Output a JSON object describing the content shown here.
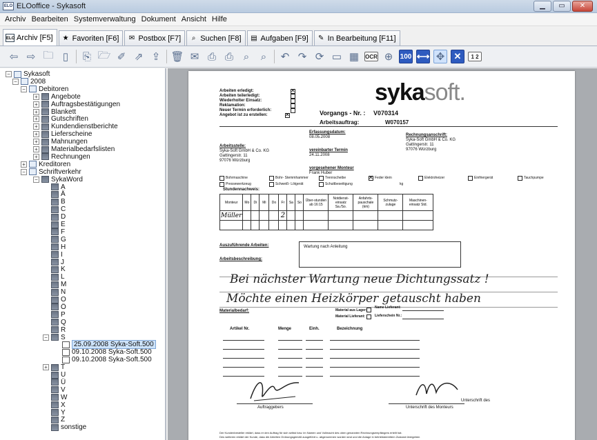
{
  "window": {
    "title": "ELOoffice - Sykasoft",
    "app_icon": "ELO",
    "controls": {
      "minimize": "▁",
      "maximize": "▭",
      "close": "✕"
    }
  },
  "menu": [
    "Archiv",
    "Bearbeiten",
    "Systemverwaltung",
    "Dokument",
    "Ansicht",
    "Hilfe"
  ],
  "tabs": [
    {
      "label": "Archiv [F5]",
      "icon": "ELO",
      "active": true
    },
    {
      "label": "Favoriten [F6]",
      "icon": "★"
    },
    {
      "label": "Postbox [F7]",
      "icon": "✉"
    },
    {
      "label": "Suchen [F8]",
      "icon": "⌕"
    },
    {
      "label": "Aufgaben [F9]",
      "icon": "▤"
    },
    {
      "label": "In Bearbeitung [F11]",
      "icon": "✎"
    }
  ],
  "toolbar_icons": [
    "back-arrow-icon",
    "forward-arrow-icon",
    "new-folder-icon",
    "new-document-icon",
    "sep",
    "insert-document-icon",
    "open-folder-icon",
    "edit-icon",
    "move-icon",
    "export-icon",
    "sep",
    "trash-icon",
    "mail-icon",
    "print-icon",
    "print-preview-icon",
    "search-doc-icon",
    "find-next-icon",
    "sep",
    "rotate-left-icon",
    "rotate-right-icon",
    "refresh-icon",
    "scanner-icon",
    "grid-icon",
    "ocr-icon",
    "zoom-in-icon",
    "zoom-100-icon",
    "fit-width-icon",
    "fit-page-icon",
    "close-doc-icon",
    "page-12-icon"
  ],
  "toolbar_labels": {
    "ocr": "OCR",
    "zoom100": "100",
    "pages": "1 2"
  },
  "tree": [
    {
      "label": "Sykasoft",
      "level": 0,
      "icon": "cab",
      "exp": "−"
    },
    {
      "label": "2008",
      "level": 1,
      "icon": "cab",
      "exp": "−"
    },
    {
      "label": "Debitoren",
      "level": 2,
      "icon": "cab",
      "exp": "−"
    },
    {
      "label": "Angebote",
      "level": 3,
      "icon": "fold",
      "exp": "+"
    },
    {
      "label": "Auftragsbestätigungen",
      "level": 3,
      "icon": "fold",
      "exp": "+"
    },
    {
      "label": "Blankett",
      "level": 3,
      "icon": "fold",
      "exp": "+"
    },
    {
      "label": "Gutschriften",
      "level": 3,
      "icon": "fold",
      "exp": "+"
    },
    {
      "label": "Kundendienstberichte",
      "level": 3,
      "icon": "fold",
      "exp": "+"
    },
    {
      "label": "Lieferscheine",
      "level": 3,
      "icon": "fold",
      "exp": "+"
    },
    {
      "label": "Mahnungen",
      "level": 3,
      "icon": "fold",
      "exp": "+"
    },
    {
      "label": "Materialbedarfslisten",
      "level": 3,
      "icon": "fold",
      "exp": "+"
    },
    {
      "label": "Rechnungen",
      "level": 3,
      "icon": "fold",
      "exp": "+"
    },
    {
      "label": "Kreditoren",
      "level": 2,
      "icon": "cab",
      "exp": "+"
    },
    {
      "label": "Schriftverkehr",
      "level": 2,
      "icon": "cab",
      "exp": "−"
    },
    {
      "label": "SykaWord",
      "level": 3,
      "icon": "fold",
      "exp": "−"
    },
    {
      "label": "A",
      "level": 4,
      "icon": "fold"
    },
    {
      "label": "Ä",
      "level": 4,
      "icon": "fold"
    },
    {
      "label": "B",
      "level": 4,
      "icon": "fold"
    },
    {
      "label": "C",
      "level": 4,
      "icon": "fold"
    },
    {
      "label": "D",
      "level": 4,
      "icon": "fold"
    },
    {
      "label": "E",
      "level": 4,
      "icon": "fold"
    },
    {
      "label": "F",
      "level": 4,
      "icon": "fold"
    },
    {
      "label": "G",
      "level": 4,
      "icon": "fold"
    },
    {
      "label": "H",
      "level": 4,
      "icon": "fold"
    },
    {
      "label": "I",
      "level": 4,
      "icon": "fold"
    },
    {
      "label": "J",
      "level": 4,
      "icon": "fold"
    },
    {
      "label": "K",
      "level": 4,
      "icon": "fold"
    },
    {
      "label": "L",
      "level": 4,
      "icon": "fold"
    },
    {
      "label": "M",
      "level": 4,
      "icon": "fold"
    },
    {
      "label": "N",
      "level": 4,
      "icon": "fold"
    },
    {
      "label": "O",
      "level": 4,
      "icon": "fold"
    },
    {
      "label": "Ö",
      "level": 4,
      "icon": "fold"
    },
    {
      "label": "P",
      "level": 4,
      "icon": "fold"
    },
    {
      "label": "Q",
      "level": 4,
      "icon": "fold"
    },
    {
      "label": "R",
      "level": 4,
      "icon": "fold"
    },
    {
      "label": "S",
      "level": 4,
      "icon": "fold",
      "exp": "−"
    },
    {
      "label": "25.09.2008  Syka-Soft.500",
      "level": 5,
      "icon": "doc",
      "selected": true
    },
    {
      "label": "09.10.2008  Syka-Soft.500",
      "level": 5,
      "icon": "doc"
    },
    {
      "label": "09.10.2008  Syka-Soft.500",
      "level": 5,
      "icon": "doc"
    },
    {
      "label": "T",
      "level": 4,
      "icon": "fold",
      "exp": "+"
    },
    {
      "label": "U",
      "level": 4,
      "icon": "fold"
    },
    {
      "label": "Ü",
      "level": 4,
      "icon": "fold"
    },
    {
      "label": "V",
      "level": 4,
      "icon": "fold"
    },
    {
      "label": "W",
      "level": 4,
      "icon": "fold"
    },
    {
      "label": "X",
      "level": 4,
      "icon": "fold"
    },
    {
      "label": "Y",
      "level": 4,
      "icon": "fold"
    },
    {
      "label": "Z",
      "level": 4,
      "icon": "fold"
    },
    {
      "label": "sonstige",
      "level": 4,
      "icon": "fold"
    }
  ],
  "doc": {
    "status_labels": [
      "Arbeiten erledigt:",
      "Arbeiten teilerledigt:",
      "Wiederholter Einsatz:",
      "Reklamation:",
      "Neuer Termin erforderlich:",
      "Angebot ist zu erstellen:"
    ],
    "logo_a": "syka",
    "logo_b": "soft.",
    "vorgang_label": "Vorgangs - Nr. :",
    "vorgang_nr": "V070314",
    "auftrag_label": "Arbeitsauftrag:",
    "auftrag_nr": "W070157",
    "arbeitsstelle_label": "Arbeitsstelle:",
    "arbeitsstelle": [
      "Syka-Soft GmbH & Co. KG",
      "Gattingerstr. 11",
      "97076 Würzburg"
    ],
    "erfassung_label": "Erfassungsdatum:",
    "erfassung": "08.05.2008",
    "termin_label": "vereinbarter Termin",
    "termin": "24.11.2008",
    "monteur_label": "vorgesehener Monteur",
    "monteur": "Frank Huber",
    "rechnung_label": "Rechnungsanschrift:",
    "rechnung": [
      "Syka-Soft GmbH & Co. KG",
      "Gattingerstr. 11",
      "97076 Würzburg"
    ],
    "tools_row1": [
      "Bohrmaschine",
      "Bohr- Stemmhammer",
      "Trennscheibe",
      "Feder klein",
      "Elektroheizer",
      "Einfriergerät",
      "Tauchpumpe"
    ],
    "tools_row2": [
      "Pressewerkzeug",
      "Schweiß- Lötgerät",
      "Schuttbeseitigung",
      "kg"
    ],
    "stunden_label": "Stundennachweis:",
    "stunden_head": [
      "Monteur",
      "Mo",
      "Di",
      "Mi",
      "Do",
      "Fr",
      "Sa",
      "So",
      "Über-stunden ab 16:15",
      "Notdienst-einsatz Sa./So.",
      "Anfahrts-pauschale (km)",
      "Schmutz-zulage",
      "Maschinen-einsatz Std."
    ],
    "stunden_hand_name": "Müller",
    "stunden_hand_val": "2",
    "auszu_label": "Auszuführende Arbeiten:",
    "auszu_text": "Wartung nach Anleitung",
    "beschr_label": "Arbeitsbeschreibung:",
    "hand_line1": "Bei nächster Wartung neue Dichtungssatz !",
    "hand_line2": "Möchte einen Heizkörper getauscht haben",
    "material_label": "Materialbedarf:",
    "lager_label": "Material aus Lager:",
    "lieferant_label": "Material Lieferant:",
    "liefer_name": "Name Lieferant:",
    "liefer_schein": "Lieferschein Nr.:",
    "mat_head": [
      "Artikel Nr.",
      "Menge",
      "Einh.",
      "Bezeichnung"
    ],
    "unterschrift_label": "Unterschrift des",
    "auftraggeber": "Auftraggebers",
    "monteur_sig": "Unterschrift des Monteurs",
    "footer1": "Der Kundenbesteller erklärt, dass er den Auftrag für sich selbst bzw. im Namen und Vollmacht des oben genannten Rechnungsempfängers erteilt hat.",
    "footer2": "Des weiteren erklärt der Kunde, dass die Arbeiten Ordnungsgemäß ausgeführt u. abgenommen worden sind und die Anlage in betriebsbereitem Zustand übergeben"
  },
  "colors": {
    "accent": "#2e5bbf",
    "tree_select": "#cde3fa",
    "doc_bg": "#a9acb0"
  }
}
